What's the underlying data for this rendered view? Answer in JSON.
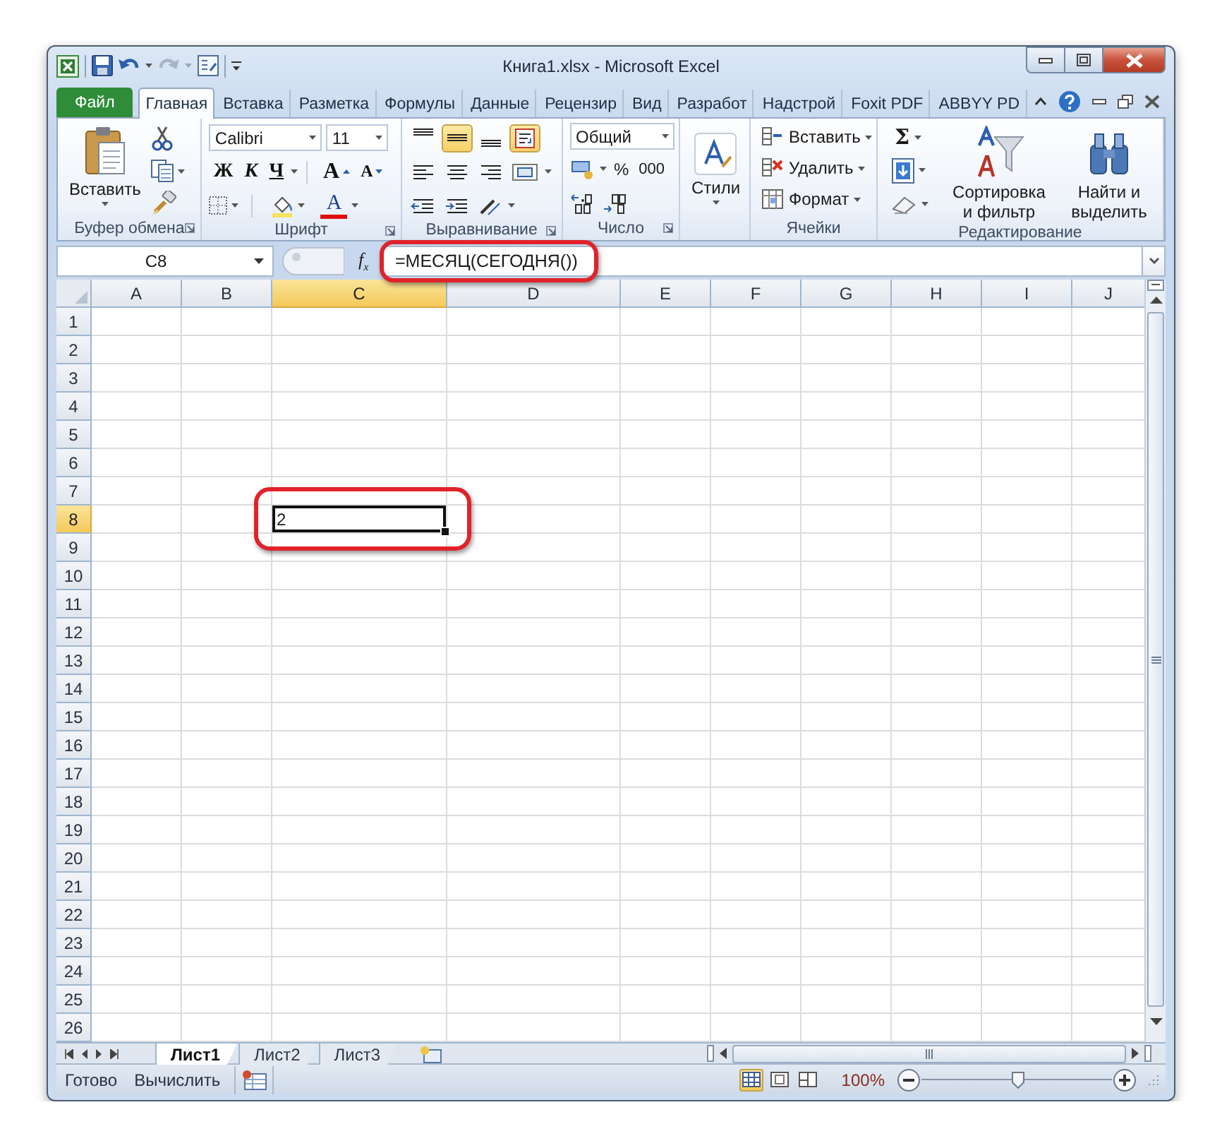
{
  "window": {
    "title": "Книга1.xlsx - Microsoft Excel"
  },
  "ribbon_tabs": [
    {
      "label": "Файл",
      "kind": "file",
      "selected": false
    },
    {
      "label": "Главная",
      "kind": "tab",
      "selected": true
    },
    {
      "label": "Вставка",
      "kind": "tab",
      "selected": false
    },
    {
      "label": "Разметка",
      "kind": "tab",
      "selected": false
    },
    {
      "label": "Формулы",
      "kind": "tab",
      "selected": false
    },
    {
      "label": "Данные",
      "kind": "tab",
      "selected": false
    },
    {
      "label": "Рецензир",
      "kind": "tab",
      "selected": false
    },
    {
      "label": "Вид",
      "kind": "tab",
      "selected": false
    },
    {
      "label": "Разработ",
      "kind": "tab",
      "selected": false
    },
    {
      "label": "Надстрой",
      "kind": "tab",
      "selected": false
    },
    {
      "label": "Foxit PDF",
      "kind": "tab",
      "selected": false
    },
    {
      "label": "ABBYY PD",
      "kind": "tab",
      "selected": false
    }
  ],
  "clipboard": {
    "paste_label": "Вставить",
    "group_label": "Буфер обмена"
  },
  "font": {
    "name": "Calibri",
    "size": "11",
    "style_buttons": [
      "Ж",
      "К",
      "Ч"
    ],
    "grow_label": "A",
    "shrink_label": "A",
    "color_label": "A",
    "group_label": "Шрифт"
  },
  "alignment": {
    "vertical": [
      {
        "selected": false
      },
      {
        "selected": true
      },
      {
        "selected": false
      }
    ],
    "wrap_text": {
      "selected": true
    },
    "group_label": "Выравнивание"
  },
  "number": {
    "format": "Общий",
    "percent": "%",
    "thousands": "000",
    "group_label": "Число"
  },
  "styles": {
    "label": "Стили"
  },
  "cells": {
    "buttons": [
      "Вставить",
      "Удалить",
      "Формат"
    ],
    "group_label": "Ячейки"
  },
  "editing": {
    "sum": "Σ",
    "sort_label": "Сортировка и фильтр",
    "find_label": "Найти и выделить",
    "group_label": "Редактирование"
  },
  "formula_bar": {
    "name_box": "C8",
    "fx": "f$_{x}$",
    "formula": "=МЕСЯЦ(СЕГОДНЯ())",
    "highlighted": true
  },
  "sheet": {
    "columns": [
      {
        "label": "A",
        "selected": false
      },
      {
        "label": "B",
        "selected": false
      },
      {
        "label": "C",
        "selected": true
      },
      {
        "label": "D",
        "selected": false
      },
      {
        "label": "E",
        "selected": false
      },
      {
        "label": "F",
        "selected": false
      },
      {
        "label": "G",
        "selected": false
      },
      {
        "label": "H",
        "selected": false
      },
      {
        "label": "I",
        "selected": false
      },
      {
        "label": "J",
        "selected": false
      }
    ],
    "rows": [
      {
        "label": "1",
        "selected": false
      },
      {
        "label": "2",
        "selected": false
      },
      {
        "label": "3",
        "selected": false
      },
      {
        "label": "4",
        "selected": false
      },
      {
        "label": "5",
        "selected": false
      },
      {
        "label": "6",
        "selected": false
      },
      {
        "label": "7",
        "selected": false
      },
      {
        "label": "8",
        "selected": true
      },
      {
        "label": "9",
        "selected": false
      },
      {
        "label": "10",
        "selected": false
      },
      {
        "label": "11",
        "selected": false
      },
      {
        "label": "12",
        "selected": false
      },
      {
        "label": "13",
        "selected": false
      },
      {
        "label": "14",
        "selected": false
      },
      {
        "label": "15",
        "selected": false
      },
      {
        "label": "16",
        "selected": false
      },
      {
        "label": "17",
        "selected": false
      },
      {
        "label": "18",
        "selected": false
      },
      {
        "label": "19",
        "selected": false
      },
      {
        "label": "20",
        "selected": false
      },
      {
        "label": "21",
        "selected": false
      },
      {
        "label": "22",
        "selected": false
      },
      {
        "label": "23",
        "selected": false
      },
      {
        "label": "24",
        "selected": false
      },
      {
        "label": "25",
        "selected": false
      },
      {
        "label": "26",
        "selected": false
      }
    ],
    "active_cell": {
      "value": "2",
      "highlighted": true
    }
  },
  "sheet_tabs": [
    {
      "label": "Лист1",
      "selected": true
    },
    {
      "label": "Лист2",
      "selected": false
    },
    {
      "label": "Лист3",
      "selected": false
    }
  ],
  "status_bar": {
    "mode": "Готово",
    "calculate": "Вычислить",
    "views": [
      {
        "selected": true
      },
      {
        "selected": false
      },
      {
        "selected": false
      }
    ],
    "zoom": "100%",
    "zoom_slider": {
      "level": 0.5
    }
  }
}
